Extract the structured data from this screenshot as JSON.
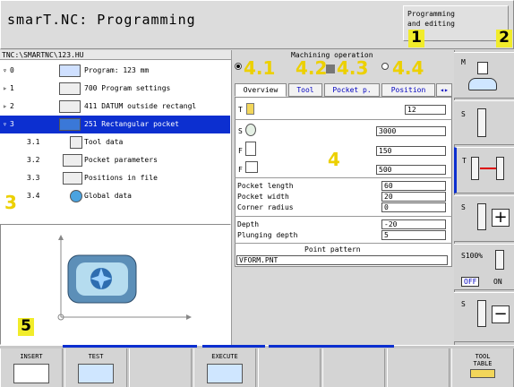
{
  "header": {
    "title": "smarT.NC: Programming",
    "mode_lines": [
      "Programming",
      "and editing"
    ]
  },
  "tree": {
    "path": "TNC:\\SMARTNC\\123.HU",
    "rows": [
      {
        "num": "0",
        "text": "Program: 123 mm",
        "arrow": "▿"
      },
      {
        "num": "1",
        "text": "700 Program settings",
        "arrow": "▹"
      },
      {
        "num": "2",
        "text": "411 DATUM outside rectangl",
        "arrow": "▹"
      },
      {
        "num": "3",
        "text": "251 Rectangular pocket",
        "arrow": "▿"
      },
      {
        "num": "3.1",
        "text": "Tool data"
      },
      {
        "num": "3.2",
        "text": "Pocket parameters"
      },
      {
        "num": "3.3",
        "text": "Positions in file"
      },
      {
        "num": "3.4",
        "text": "Global data"
      }
    ]
  },
  "form": {
    "title": "Machining operation",
    "tabs": [
      "Overview",
      "Tool",
      "Pocket p.",
      "Position"
    ],
    "tool": {
      "label": "T",
      "value": "12"
    },
    "spindle": {
      "label": "S",
      "value": "3000"
    },
    "feed1": {
      "label": "F",
      "value": "150"
    },
    "feed2": {
      "label": "F",
      "value": "500"
    },
    "params": [
      {
        "label": "Pocket length",
        "value": "60"
      },
      {
        "label": "Pocket width",
        "value": "20"
      },
      {
        "label": "Corner radius",
        "value": "0"
      },
      {
        "label": "Depth",
        "value": "-20"
      },
      {
        "label": "Plunging depth",
        "value": "5"
      }
    ],
    "pattern_title": "Point pattern",
    "pattern_value": "VFORM.PNT"
  },
  "callouts": {
    "c1": "1",
    "c2": "2",
    "c3": "3",
    "c4": "4",
    "c5": "5",
    "c41": "4.1",
    "c42": "4.2",
    "c43": "4.3",
    "c44": "4.4"
  },
  "side": {
    "m": "M",
    "s": "S",
    "t": "T",
    "s100": "S100%",
    "off": "OFF",
    "on": "ON"
  },
  "softkeys": {
    "insert": "INSERT",
    "test": "TEST",
    "execute": "EXECUTE",
    "tool_table": [
      "TOOL",
      "TABLE"
    ]
  },
  "colors": {
    "accent": "#0c2fd0",
    "callout": "#f1ec2a",
    "bg": "#d8d8d8"
  }
}
